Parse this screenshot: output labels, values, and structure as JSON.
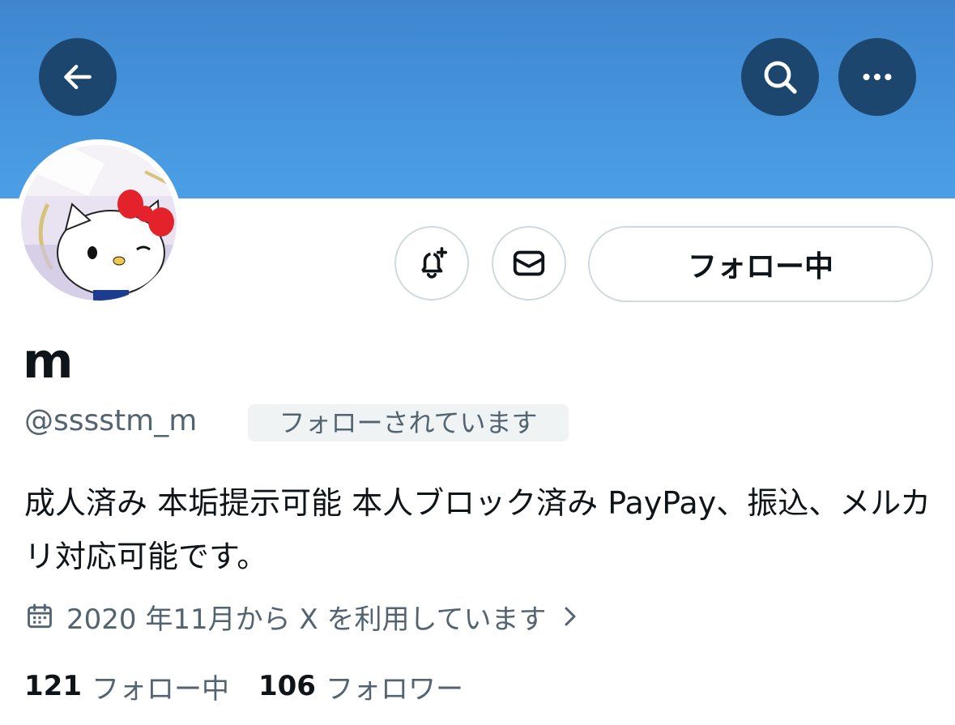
{
  "header": {
    "back_icon": "arrow-left-icon",
    "search_icon": "search-icon",
    "more_icon": "more-horizontal-icon",
    "banner_color": "#4b9fe6"
  },
  "profile": {
    "avatar_desc": "avatar",
    "display_name": "m",
    "handle": "@sssstm_m",
    "follows_you": "フォローされています",
    "bio": "成人済み 本垢提示可能 本人ブロック済み PayPay、振込、メルカリ対応可能です。",
    "joined": "2020 年11月から X を利用しています",
    "following_count": "121",
    "following_label": "フォロー中",
    "followers_count": "106",
    "followers_label": "フォロワー"
  },
  "actions": {
    "notify_icon": "bell-plus-icon",
    "message_icon": "envelope-icon",
    "follow_label": "フォロー中"
  },
  "colors": {
    "text_primary": "#0f1419",
    "text_secondary": "#536471",
    "border": "#cfd9de",
    "round_button": "#1d466e"
  }
}
